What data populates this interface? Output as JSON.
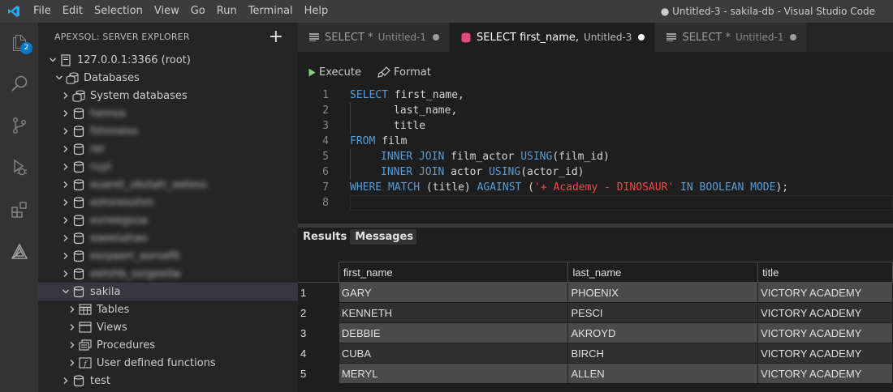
{
  "window": {
    "title": "● Untitled-3 - sakila-db - Visual Studio Code",
    "menu": [
      "File",
      "Edit",
      "Selection",
      "View",
      "Go",
      "Run",
      "Terminal",
      "Help"
    ]
  },
  "activity_bar": {
    "explorer_badge": "2",
    "icons": [
      "explorer-icon",
      "search-icon",
      "source-control-icon",
      "debug-icon",
      "extensions-icon",
      "apexsql-icon"
    ]
  },
  "sidebar": {
    "title": "APEXSQL: SERVER EXPLORER",
    "add_label": "+",
    "server": "127.0.0.1:3366 (root)",
    "databases_label": "Databases",
    "system_databases": "System databases",
    "hidden_databases": [
      "hemsa",
      "fshnneso",
      "rer",
      "ruyt",
      "euaret_vbstatr_eetess",
      "eshsresohm",
      "evneegsoa",
      "eaeesahao",
      "esrpaerr_aorsefit",
      "eetshb_ssrgeeilw"
    ],
    "sakila": "sakila",
    "sakila_children": [
      "Tables",
      "Views",
      "Procedures",
      "User defined functions"
    ],
    "test": "test"
  },
  "tabs": [
    {
      "label": "SELECT *",
      "sub": "Untitled-1",
      "active": false
    },
    {
      "label": "SELECT first_name,",
      "sub": "Untitled-3",
      "active": true
    },
    {
      "label": "SELECT *",
      "sub": "Untitled-1",
      "active": false
    }
  ],
  "toolbar": {
    "execute_label": "Execute",
    "format_label": "Format"
  },
  "editor": {
    "line_numbers": [
      "1",
      "2",
      "3",
      "4",
      "5",
      "6",
      "7",
      "8"
    ],
    "line1": {
      "kw": "SELECT",
      "rest": " first_name,"
    },
    "line2": "last_name,",
    "line3": "title",
    "line4": {
      "kw": "FROM",
      "rest": " film"
    },
    "line5": {
      "kw": "INNER JOIN",
      "mid": " film_actor ",
      "kw2": "USING",
      "rest": "(film_id)"
    },
    "line6": {
      "kw": "INNER JOIN",
      "mid": " actor ",
      "kw2": "USING",
      "rest": "(actor_id)"
    },
    "line7": {
      "kw": "WHERE",
      "sp1": " ",
      "kw2": "MATCH",
      "mid": " (title) ",
      "kw3": "AGAINST",
      "mid2": " (",
      "str": "'+ Academy - DINOSAUR'",
      "sp2": " ",
      "kw4": "IN BOOLEAN MODE",
      "end": ");"
    }
  },
  "results": {
    "tabs": [
      "Results",
      "Messages"
    ],
    "columns": [
      "first_name",
      "last_name",
      "title"
    ],
    "rows": [
      {
        "idx": "1",
        "first_name": "GARY",
        "last_name": "PHOENIX",
        "title": "VICTORY ACADEMY"
      },
      {
        "idx": "2",
        "first_name": "KENNETH",
        "last_name": "PESCI",
        "title": "VICTORY ACADEMY"
      },
      {
        "idx": "3",
        "first_name": "DEBBIE",
        "last_name": "AKROYD",
        "title": "VICTORY ACADEMY"
      },
      {
        "idx": "4",
        "first_name": "CUBA",
        "last_name": "BIRCH",
        "title": "VICTORY ACADEMY"
      },
      {
        "idx": "5",
        "first_name": "MERYL",
        "last_name": "ALLEN",
        "title": "VICTORY ACADEMY"
      }
    ]
  },
  "colors": {
    "accent": "#007acc",
    "keyword": "#569cd6",
    "string": "#f44747"
  }
}
